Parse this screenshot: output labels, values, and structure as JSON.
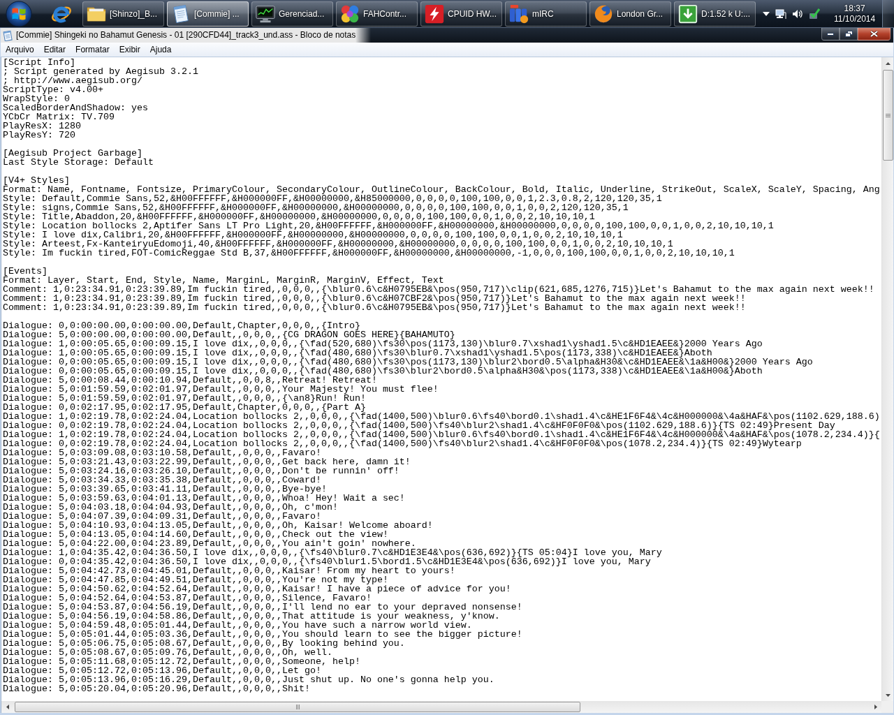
{
  "taskbar": {
    "tasks": [
      {
        "label": "[Shinzo]_B...",
        "selected": false
      },
      {
        "label": "[Commie] ...",
        "selected": true
      },
      {
        "label": "Gerenciad...",
        "selected": false
      },
      {
        "label": "FAHContr...",
        "selected": false
      },
      {
        "label": "CPUID HW...",
        "selected": false
      },
      {
        "label": "mIRC",
        "selected": false
      },
      {
        "label": "London Gr...",
        "selected": false
      },
      {
        "label": "D:1.52 k U:...",
        "selected": false
      }
    ],
    "clock": {
      "time": "18:37",
      "date": "11/10/2014"
    }
  },
  "window": {
    "title": "[Commie] Shingeki no Bahamut Genesis - 01 [290CFD44]_track3_und.ass - Bloco de notas"
  },
  "menu": [
    "Arquivo",
    "Editar",
    "Formatar",
    "Exibir",
    "Ajuda"
  ],
  "document": {
    "blocks": [
      [
        "[Script Info]",
        "; Script generated by Aegisub 3.2.1",
        "; http://www.aegisub.org/",
        "ScriptType: v4.00+",
        "WrapStyle: 0",
        "ScaledBorderAndShadow: yes",
        "YCbCr Matrix: TV.709",
        "PlayResX: 1280",
        "PlayResY: 720"
      ],
      [
        "[Aegisub Project Garbage]",
        "Last Style Storage: Default"
      ],
      [
        "[V4+ Styles]",
        "Format: Name, Fontname, Fontsize, PrimaryColour, SecondaryColour, OutlineColour, BackColour, Bold, Italic, Underline, StrikeOut, ScaleX, ScaleY, Spacing, Ang",
        "Style: Default,Commie Sans,52,&H00FFFFFF,&H000000FF,&H00000000,&H85000000,0,0,0,0,100,100,0,0,1,2.3,0.8,2,120,120,35,1",
        "Style: signs,Commie Sans,52,&H00FFFFFF,&H000000FF,&H00000000,&H00000000,0,0,0,0,100,100,0,0,1,0,0,2,120,120,35,1",
        "Style: Title,Abaddon,20,&H00FFFFFF,&H000000FF,&H00000000,&H00000000,0,0,0,0,100,100,0,0,1,0,0,2,10,10,10,1",
        "Style: Location bollocks 2,Aptifer Sans LT Pro Light,20,&H00FFFFFF,&H000000FF,&H00000000,&H00000000,0,0,0,0,100,100,0,0,1,0,0,2,10,10,10,1",
        "Style: I love dix,Calibri,20,&H00FFFFFF,&H000000FF,&H00000000,&H00000000,0,0,0,0,100,100,0,0,1,0,0,2,10,10,10,1",
        "Style: Arteest,Fx-KanteiryuEdomoji,40,&H00FFFFFF,&H000000FF,&H00000000,&H00000000,0,0,0,0,100,100,0,0,1,0,0,2,10,10,10,1",
        "Style: Im fuckin tired,FOT-ComicReggae Std B,37,&H00FFFFFF,&H000000FF,&H00000000,&H00000000,-1,0,0,0,100,100,0,0,1,0,0,2,10,10,10,1"
      ],
      [
        "[Events]",
        "Format: Layer, Start, End, Style, Name, MarginL, MarginR, MarginV, Effect, Text",
        "Comment: 1,0:23:34.91,0:23:39.89,Im fuckin tired,,0,0,0,,{\\blur0.6\\c&H0795EB&\\pos(950,717)\\clip(621,685,1276,715)}Let's Bahamut to the max again next week!!",
        "Comment: 1,0:23:34.91,0:23:39.89,Im fuckin tired,,0,0,0,,{\\blur0.6\\c&H07CBF2&\\pos(950,717)}Let's Bahamut to the max again next week!!",
        "Comment: 1,0:23:34.91,0:23:39.89,Im fuckin tired,,0,0,0,,{\\blur0.6\\c&H0795EB&\\pos(950,717)}Let's Bahamut to the max again next week!!"
      ],
      [
        "Dialogue: 0,0:00:00.00,0:00:00.00,Default,Chapter,0,0,0,,{Intro}",
        "Dialogue: 5,0:00:00.00,0:00:00.00,Default,,0,0,0,,{CG DRAGON GOES HERE}{BAHAMUTO}",
        "Dialogue: 1,0:00:05.65,0:00:09.15,I love dix,,0,0,0,,{\\fad(520,680)\\fs30\\pos(1173,130)\\blur0.7\\xshad1\\yshad1.5\\c&HD1EAEE&}2000 Years Ago",
        "Dialogue: 1,0:00:05.65,0:00:09.15,I love dix,,0,0,0,,{\\fad(480,680)\\fs30\\blur0.7\\xshad1\\yshad1.5\\pos(1173,338)\\c&HD1EAEE&}Aboth",
        "Dialogue: 0,0:00:05.65,0:00:09.15,I love dix,,0,0,0,,{\\fad(480,680)\\fs30\\pos(1173,130)\\blur2\\bord0.5\\alpha&H30&\\c&HD1EAEE&\\1a&H00&}2000 Years Ago",
        "Dialogue: 0,0:00:05.65,0:00:09.15,I love dix,,0,0,0,,{\\fad(480,680)\\fs30\\blur2\\bord0.5\\alpha&H30&\\pos(1173,338)\\c&HD1EAEE&\\1a&H00&}Aboth",
        "Dialogue: 5,0:00:08.44,0:00:10.94,Default,,0,0,8,,Retreat! Retreat!",
        "Dialogue: 5,0:01:59.59,0:02:01.97,Default,,0,0,0,,Your Majesty! You must flee!",
        "Dialogue: 5,0:01:59.59,0:02:01.97,Default,,0,0,0,,{\\an8}Run! Run!",
        "Dialogue: 0,0:02:17.95,0:02:17.95,Default,Chapter,0,0,0,,{Part A}",
        "Dialogue: 1,0:02:19.78,0:02:24.04,Location bollocks 2,,0,0,0,,{\\fad(1400,500)\\blur0.6\\fs40\\bord0.1\\shad1.4\\c&HE1F6F4&\\4c&H000000&\\4a&HAF&\\pos(1102.629,188.6)",
        "Dialogue: 0,0:02:19.78,0:02:24.04,Location bollocks 2,,0,0,0,,{\\fad(1400,500)\\fs40\\blur2\\shad1.4\\c&HF0F0F0&\\pos(1102.629,188.6)}{TS 02:49}Present Day",
        "Dialogue: 1,0:02:19.78,0:02:24.04,Location bollocks 2,,0,0,0,,{\\fad(1400,500)\\blur0.6\\fs40\\bord0.1\\shad1.4\\c&HE1F6F4&\\4c&H000000&\\4a&HAF&\\pos(1078.2,234.4)}{",
        "Dialogue: 0,0:02:19.78,0:02:24.04,Location bollocks 2,,0,0,0,,{\\fad(1400,500)\\fs40\\blur2\\shad1.4\\c&HF0F0F0&\\pos(1078.2,234.4)}{TS 02:49}Wytearp",
        "Dialogue: 5,0:03:09.08,0:03:10.58,Default,,0,0,0,,Favaro!",
        "Dialogue: 5,0:03:21.43,0:03:22.99,Default,,0,0,0,,Get back here, damn it!",
        "Dialogue: 5,0:03:24.16,0:03:26.10,Default,,0,0,0,,Don't be runnin' off!",
        "Dialogue: 5,0:03:34.33,0:03:35.38,Default,,0,0,0,,Coward!",
        "Dialogue: 5,0:03:39.65,0:03:41.11,Default,,0,0,0,,Bye-bye!",
        "Dialogue: 5,0:03:59.63,0:04:01.13,Default,,0,0,0,,Whoa! Hey! Wait a sec!",
        "Dialogue: 5,0:04:03.18,0:04:04.93,Default,,0,0,0,,Oh, c'mon!",
        "Dialogue: 5,0:04:07.39,0:04:09.31,Default,,0,0,0,,Favaro!",
        "Dialogue: 5,0:04:10.93,0:04:13.05,Default,,0,0,0,,Oh, Kaisar! Welcome aboard!",
        "Dialogue: 5,0:04:13.05,0:04:14.60,Default,,0,0,0,,Check out the view!",
        "Dialogue: 5,0:04:22.00,0:04:23.89,Default,,0,0,0,,You ain't goin' nowhere.",
        "Dialogue: 1,0:04:35.42,0:04:36.50,I love dix,,0,0,0,,{\\fs40\\blur0.7\\c&HD1E3E4&\\pos(636,692)}{TS 05:04}I love you, Mary",
        "Dialogue: 0,0:04:35.42,0:04:36.50,I love dix,,0,0,0,,{\\fs40\\blur1.5\\bord1.5\\c&HD1E3E4&\\pos(636,692)}I love you, Mary",
        "Dialogue: 5,0:04:42.73,0:04:45.01,Default,,0,0,0,,Kaisar! From my heart to yours!",
        "Dialogue: 5,0:04:47.85,0:04:49.51,Default,,0,0,0,,You're not my type!",
        "Dialogue: 5,0:04:50.62,0:04:52.64,Default,,0,0,0,,Kaisar! I have a piece of advice for you!",
        "Dialogue: 5,0:04:52.64,0:04:53.87,Default,,0,0,0,,Silence, Favaro!",
        "Dialogue: 5,0:04:53.87,0:04:56.19,Default,,0,0,0,,I'll lend no ear to your depraved nonsense!",
        "Dialogue: 5,0:04:56.19,0:04:58.86,Default,,0,0,0,,That attitude is your weakness, y'know.",
        "Dialogue: 5,0:04:59.48,0:05:01.44,Default,,0,0,0,,You have such a narrow world view.",
        "Dialogue: 5,0:05:01.44,0:05:03.36,Default,,0,0,0,,You should learn to see the bigger picture!",
        "Dialogue: 5,0:05:06.75,0:05:08.67,Default,,0,0,0,,By looking behind you.",
        "Dialogue: 5,0:05:08.67,0:05:09.76,Default,,0,0,0,,Oh, well.",
        "Dialogue: 5,0:05:11.68,0:05:12.72,Default,,0,0,0,,Someone, help!",
        "Dialogue: 5,0:05:12.72,0:05:13.96,Default,,0,0,0,,Let go!",
        "Dialogue: 5,0:05:13.96,0:05:16.29,Default,,0,0,0,,Just shut up. No one's gonna help you.",
        "Dialogue: 5,0:05:20.04,0:05:20.96,Default,,0,0,0,,Shit!"
      ]
    ]
  }
}
